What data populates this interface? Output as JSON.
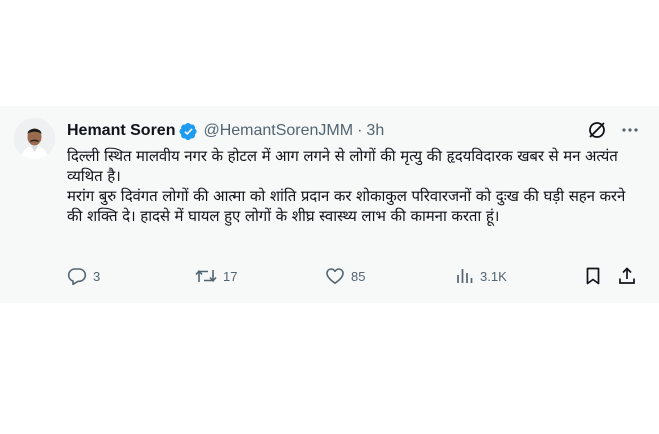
{
  "tweet": {
    "author_name": "Hemant Soren",
    "handle": "@HemantSorenJMM",
    "separator": "·",
    "time": "3h",
    "text": "दिल्ली स्थित मालवीय नगर के होटल में आग लगने से लोगों की मृत्यु की हृदयविदारक खबर से मन अत्यंत व्यथित है।\nमरांग बुरु दिवंगत लोगों की आत्मा को शांति प्रदान कर शोकाकुल परिवारजनों को दुःख की घड़ी सहन करने की शक्ति दे। हादसे में घायल हुए लोगों के शीघ्र स्वास्थ्य लाभ की कामना करता हूं।",
    "replies": "3",
    "retweets": "17",
    "likes": "85",
    "views": "3.1K"
  },
  "icons": {
    "verified": "verified-badge-icon",
    "grok": "grok-icon",
    "more": "more-icon",
    "reply": "reply-icon",
    "retweet": "retweet-icon",
    "like": "like-icon",
    "views": "views-icon",
    "bookmark": "bookmark-icon",
    "share": "share-icon"
  },
  "colors": {
    "background": "#f7f9f9",
    "text": "#0f1419",
    "muted": "#536471",
    "verified": "#1d9bf0"
  }
}
